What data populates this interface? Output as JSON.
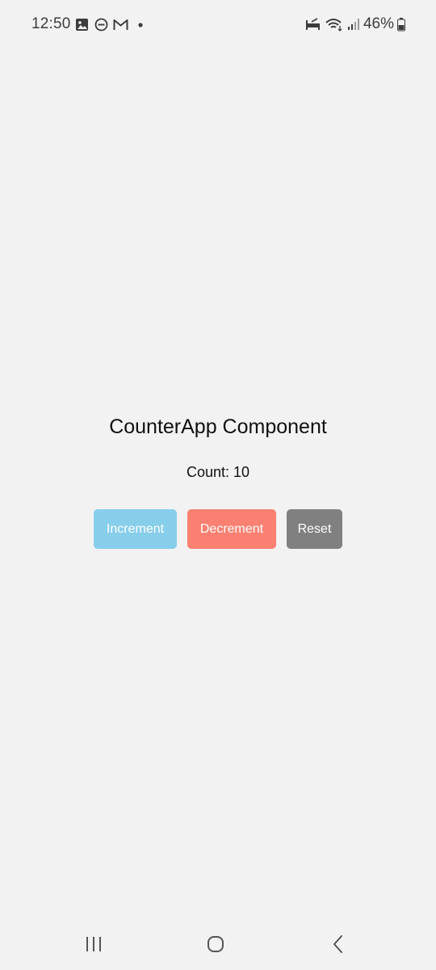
{
  "status_bar": {
    "time": "12:50",
    "battery_level": "46%",
    "notification_icons": [
      "image-icon",
      "do-not-disturb-icon",
      "gmail-icon",
      "dot-icon"
    ],
    "system_icons": [
      "sleep-mode-icon",
      "wifi-icon",
      "signal-icon",
      "battery-icon"
    ]
  },
  "main": {
    "title": "CounterApp Component",
    "count_label": "Count: 10",
    "buttons": {
      "increment": "Increment",
      "decrement": "Decrement",
      "reset": "Reset"
    }
  },
  "colors": {
    "increment": "#87ceeb",
    "decrement": "#fa8072",
    "reset": "#808080",
    "background": "#f2f2f2"
  },
  "nav_bar": {
    "icons": [
      "recent-apps-icon",
      "home-icon",
      "back-icon"
    ]
  }
}
